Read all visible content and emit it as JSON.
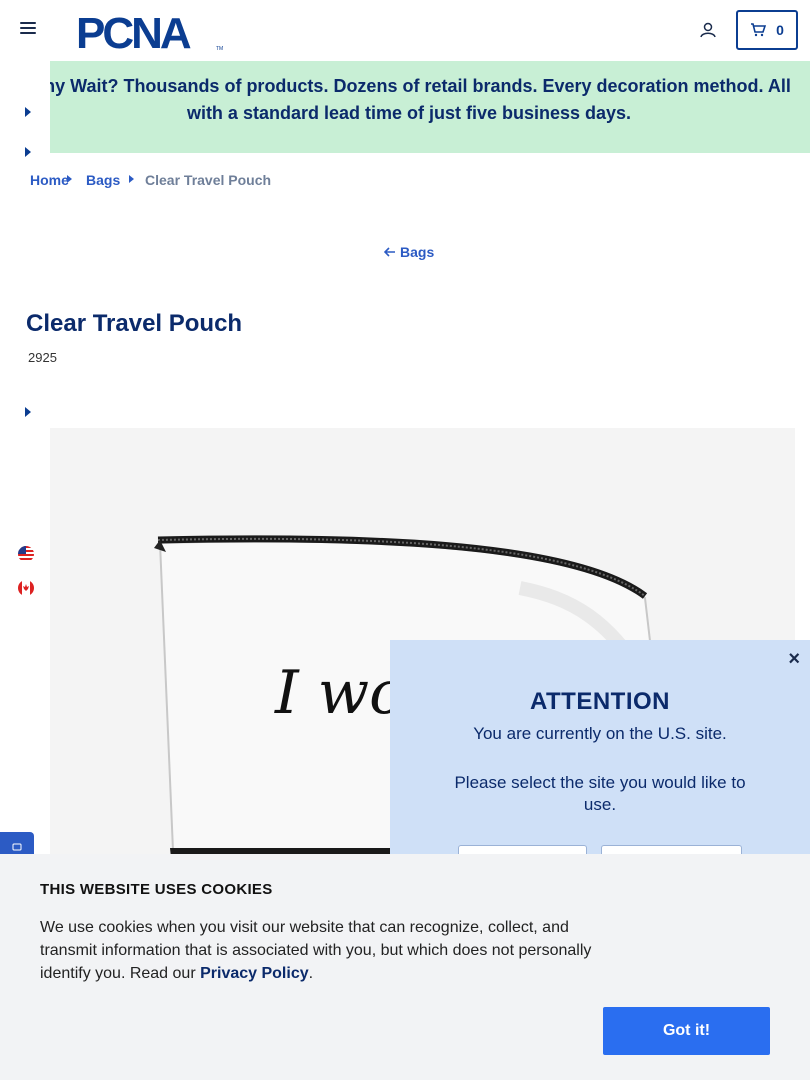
{
  "header": {
    "brand": "PCNA",
    "brand_tm": "TM",
    "cart_count": "0"
  },
  "promo": {
    "text": "Why Wait? Thousands of products. Dozens of retail brands. Every decoration method. All with a standard lead time of just five business days."
  },
  "breadcrumb": {
    "home": "Home",
    "bags": "Bags",
    "current": "Clear Travel Pouch"
  },
  "back_link": "Bags",
  "product": {
    "title": "Clear Travel Pouch",
    "sku": "2925",
    "imprint_text": "I woke up like"
  },
  "attention": {
    "close": "×",
    "title": "ATTENTION",
    "message1": "You are currently on the U.S. site.",
    "message2": "Please select the site you would like to use."
  },
  "cookie": {
    "title": "THIS WEBSITE USES COOKIES",
    "body": "We use cookies when you visit our website that can recognize, collect, and transmit information that is associated with you, but which does not personally identify you. Read our ",
    "link": "Privacy Policy",
    "period": ".",
    "button": "Got it!"
  },
  "colors": {
    "primary": "#0b3d91",
    "navy": "#0b2a6b",
    "link": "#2c5bc4",
    "promo_bg": "#c8efd5",
    "popup_bg": "#cfe0f7",
    "cookie_btn": "#2a6ef0"
  }
}
